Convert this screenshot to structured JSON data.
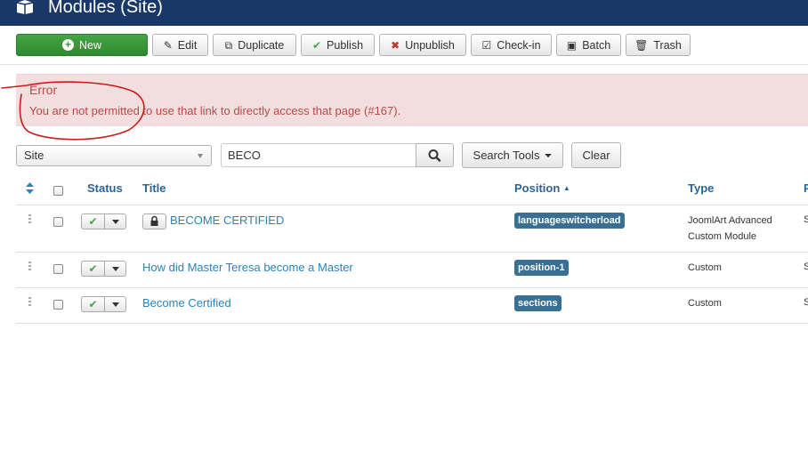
{
  "header": {
    "title": "Modules (Site)",
    "icon": "cube-icon"
  },
  "toolbar": {
    "new": "New",
    "edit": "Edit",
    "duplicate": "Duplicate",
    "publish": "Publish",
    "unpublish": "Unpublish",
    "checkin": "Check-in",
    "batch": "Batch",
    "trash": "Trash"
  },
  "alert": {
    "heading": "Error",
    "message": "You are not permitted to use that link to directly access that page (#167)."
  },
  "filters": {
    "client": "Site",
    "search_value": "BECO",
    "search_tools": "Search Tools",
    "clear": "Clear"
  },
  "table": {
    "headers": {
      "status": "Status",
      "title": "Title",
      "position": "Position",
      "type": "Type",
      "pages_truncated": "P"
    },
    "rows": [
      {
        "title": "BECOME CERTIFIED",
        "locked": true,
        "position": "languageswitcherload",
        "type_line1": "JoomlArt Advanced",
        "type_line2": "Custom Module",
        "pages_truncated": "S"
      },
      {
        "title": "How did Master Teresa become a Master",
        "locked": false,
        "position": "position-1",
        "type_line1": "Custom",
        "type_line2": "",
        "pages_truncated": "S"
      },
      {
        "title": "Become Certified",
        "locked": false,
        "position": "sections",
        "type_line1": "Custom",
        "type_line2": "",
        "pages_truncated": "S"
      }
    ]
  },
  "colors": {
    "header_bg": "#1a3867",
    "new_button": "#3a963a",
    "alert_bg": "#f2dede",
    "alert_text": "#b94a48",
    "link": "#2a83b8",
    "badge": "#3a6f94",
    "annotation": "#c81e1e"
  }
}
